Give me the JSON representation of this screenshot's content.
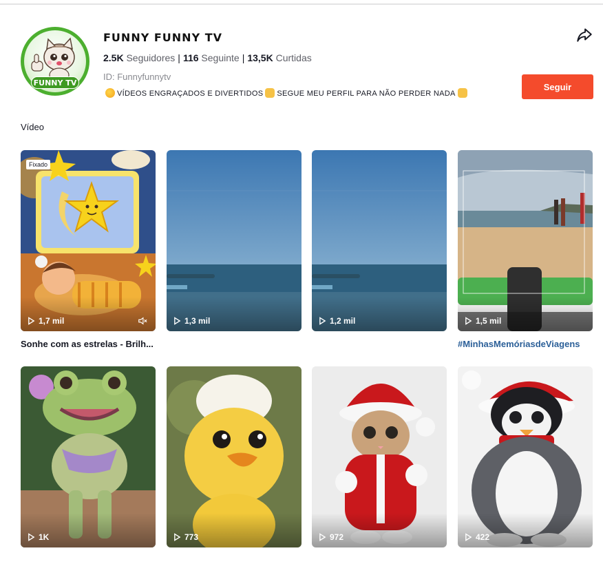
{
  "profile": {
    "avatar_text": "FUNNY TV",
    "name": "FUNNY FUNNY TV",
    "followers_count": "2.5K",
    "followers_label": "Seguidores",
    "following_count": "116",
    "following_label": "Seguinte",
    "likes_count": "13,5K",
    "likes_label": "Curtidas",
    "id_text": "ID: Funnyfunnytv",
    "bio_part1": "VÍDEOS ENGRAÇADOS E DIVERTIDOS",
    "bio_part2": "SEGUE MEU PERFIL PARA NÃO PERDER NADA",
    "follow_label": "Seguir"
  },
  "icons": {
    "share": "share-icon",
    "play": "play-icon",
    "mute": "mute-icon"
  },
  "colors": {
    "follow_button": "#f44b2c",
    "hashtag": "#2b5f98"
  },
  "section": {
    "label": "Vídeo"
  },
  "videos": [
    {
      "views": "1,7 mil",
      "pinned": "Fixado",
      "caption": "Sonhe com as estrelas - Brilh..."
    },
    {
      "views": "1,3 mil",
      "caption": ""
    },
    {
      "views": "1,2 mil",
      "caption": ""
    },
    {
      "views": "1,5 mil",
      "caption": "#MinhasMemóriasdeViagens"
    },
    {
      "views": "1K"
    },
    {
      "views": "773"
    },
    {
      "views": "972"
    },
    {
      "views": "422"
    }
  ]
}
